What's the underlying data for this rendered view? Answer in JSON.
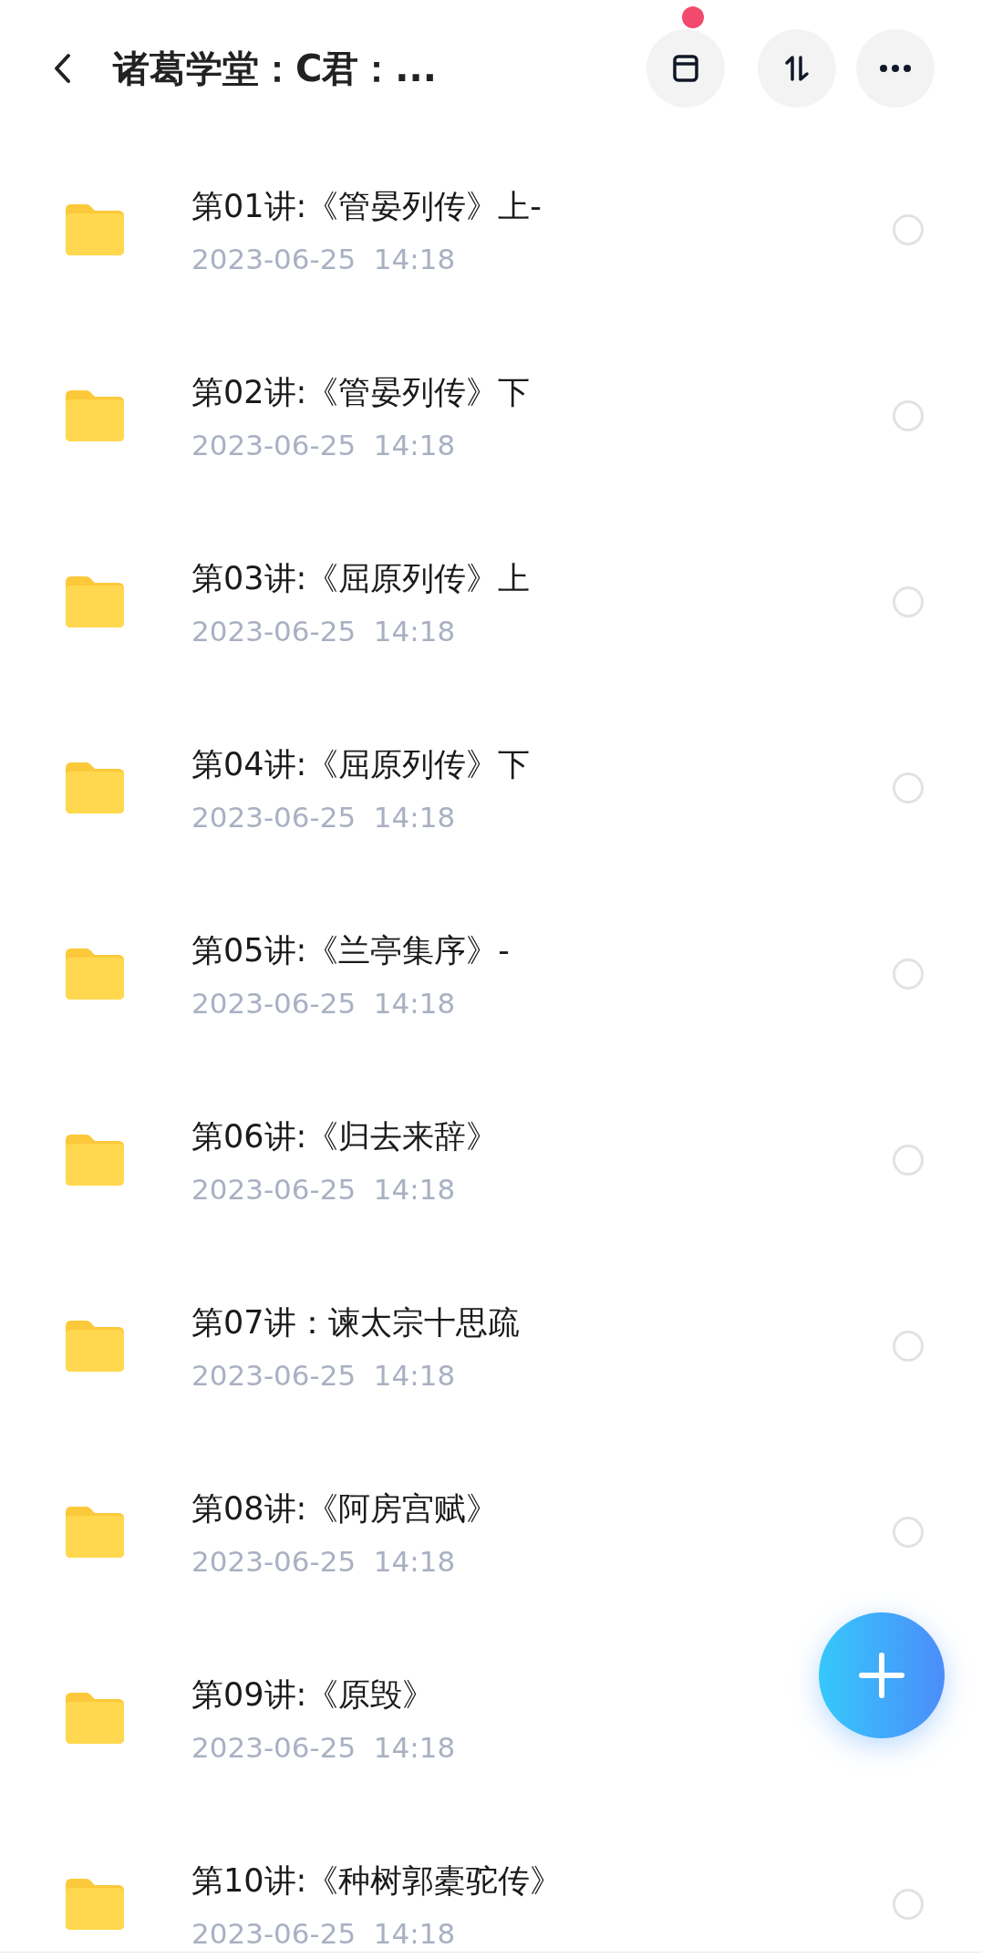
{
  "header": {
    "title": "诸葛学堂：C君：...",
    "archive_badge": true
  },
  "files": [
    {
      "name": "第01讲:《管晏列传》上-",
      "date": "2023-06-25  14:18",
      "selected": false
    },
    {
      "name": "第02讲:《管晏列传》下",
      "date": "2023-06-25  14:18",
      "selected": false
    },
    {
      "name": "第03讲:《屈原列传》上",
      "date": "2023-06-25  14:18",
      "selected": false
    },
    {
      "name": "第04讲:《屈原列传》下",
      "date": "2023-06-25  14:18",
      "selected": false
    },
    {
      "name": "第05讲:《兰亭集序》-",
      "date": "2023-06-25  14:18",
      "selected": false
    },
    {
      "name": "第06讲:《归去来辞》",
      "date": "2023-06-25  14:18",
      "selected": false
    },
    {
      "name": "第07讲：谏太宗十思疏",
      "date": "2023-06-25  14:18",
      "selected": false
    },
    {
      "name": "第08讲:《阿房宫赋》",
      "date": "2023-06-25  14:18",
      "selected": false
    },
    {
      "name": "第09讲:《原毁》",
      "date": "2023-06-25  14:18"
    },
    {
      "name": "第10讲:《种树郭橐驼传》",
      "date": "2023-06-25  14:18",
      "selected": false
    }
  ]
}
